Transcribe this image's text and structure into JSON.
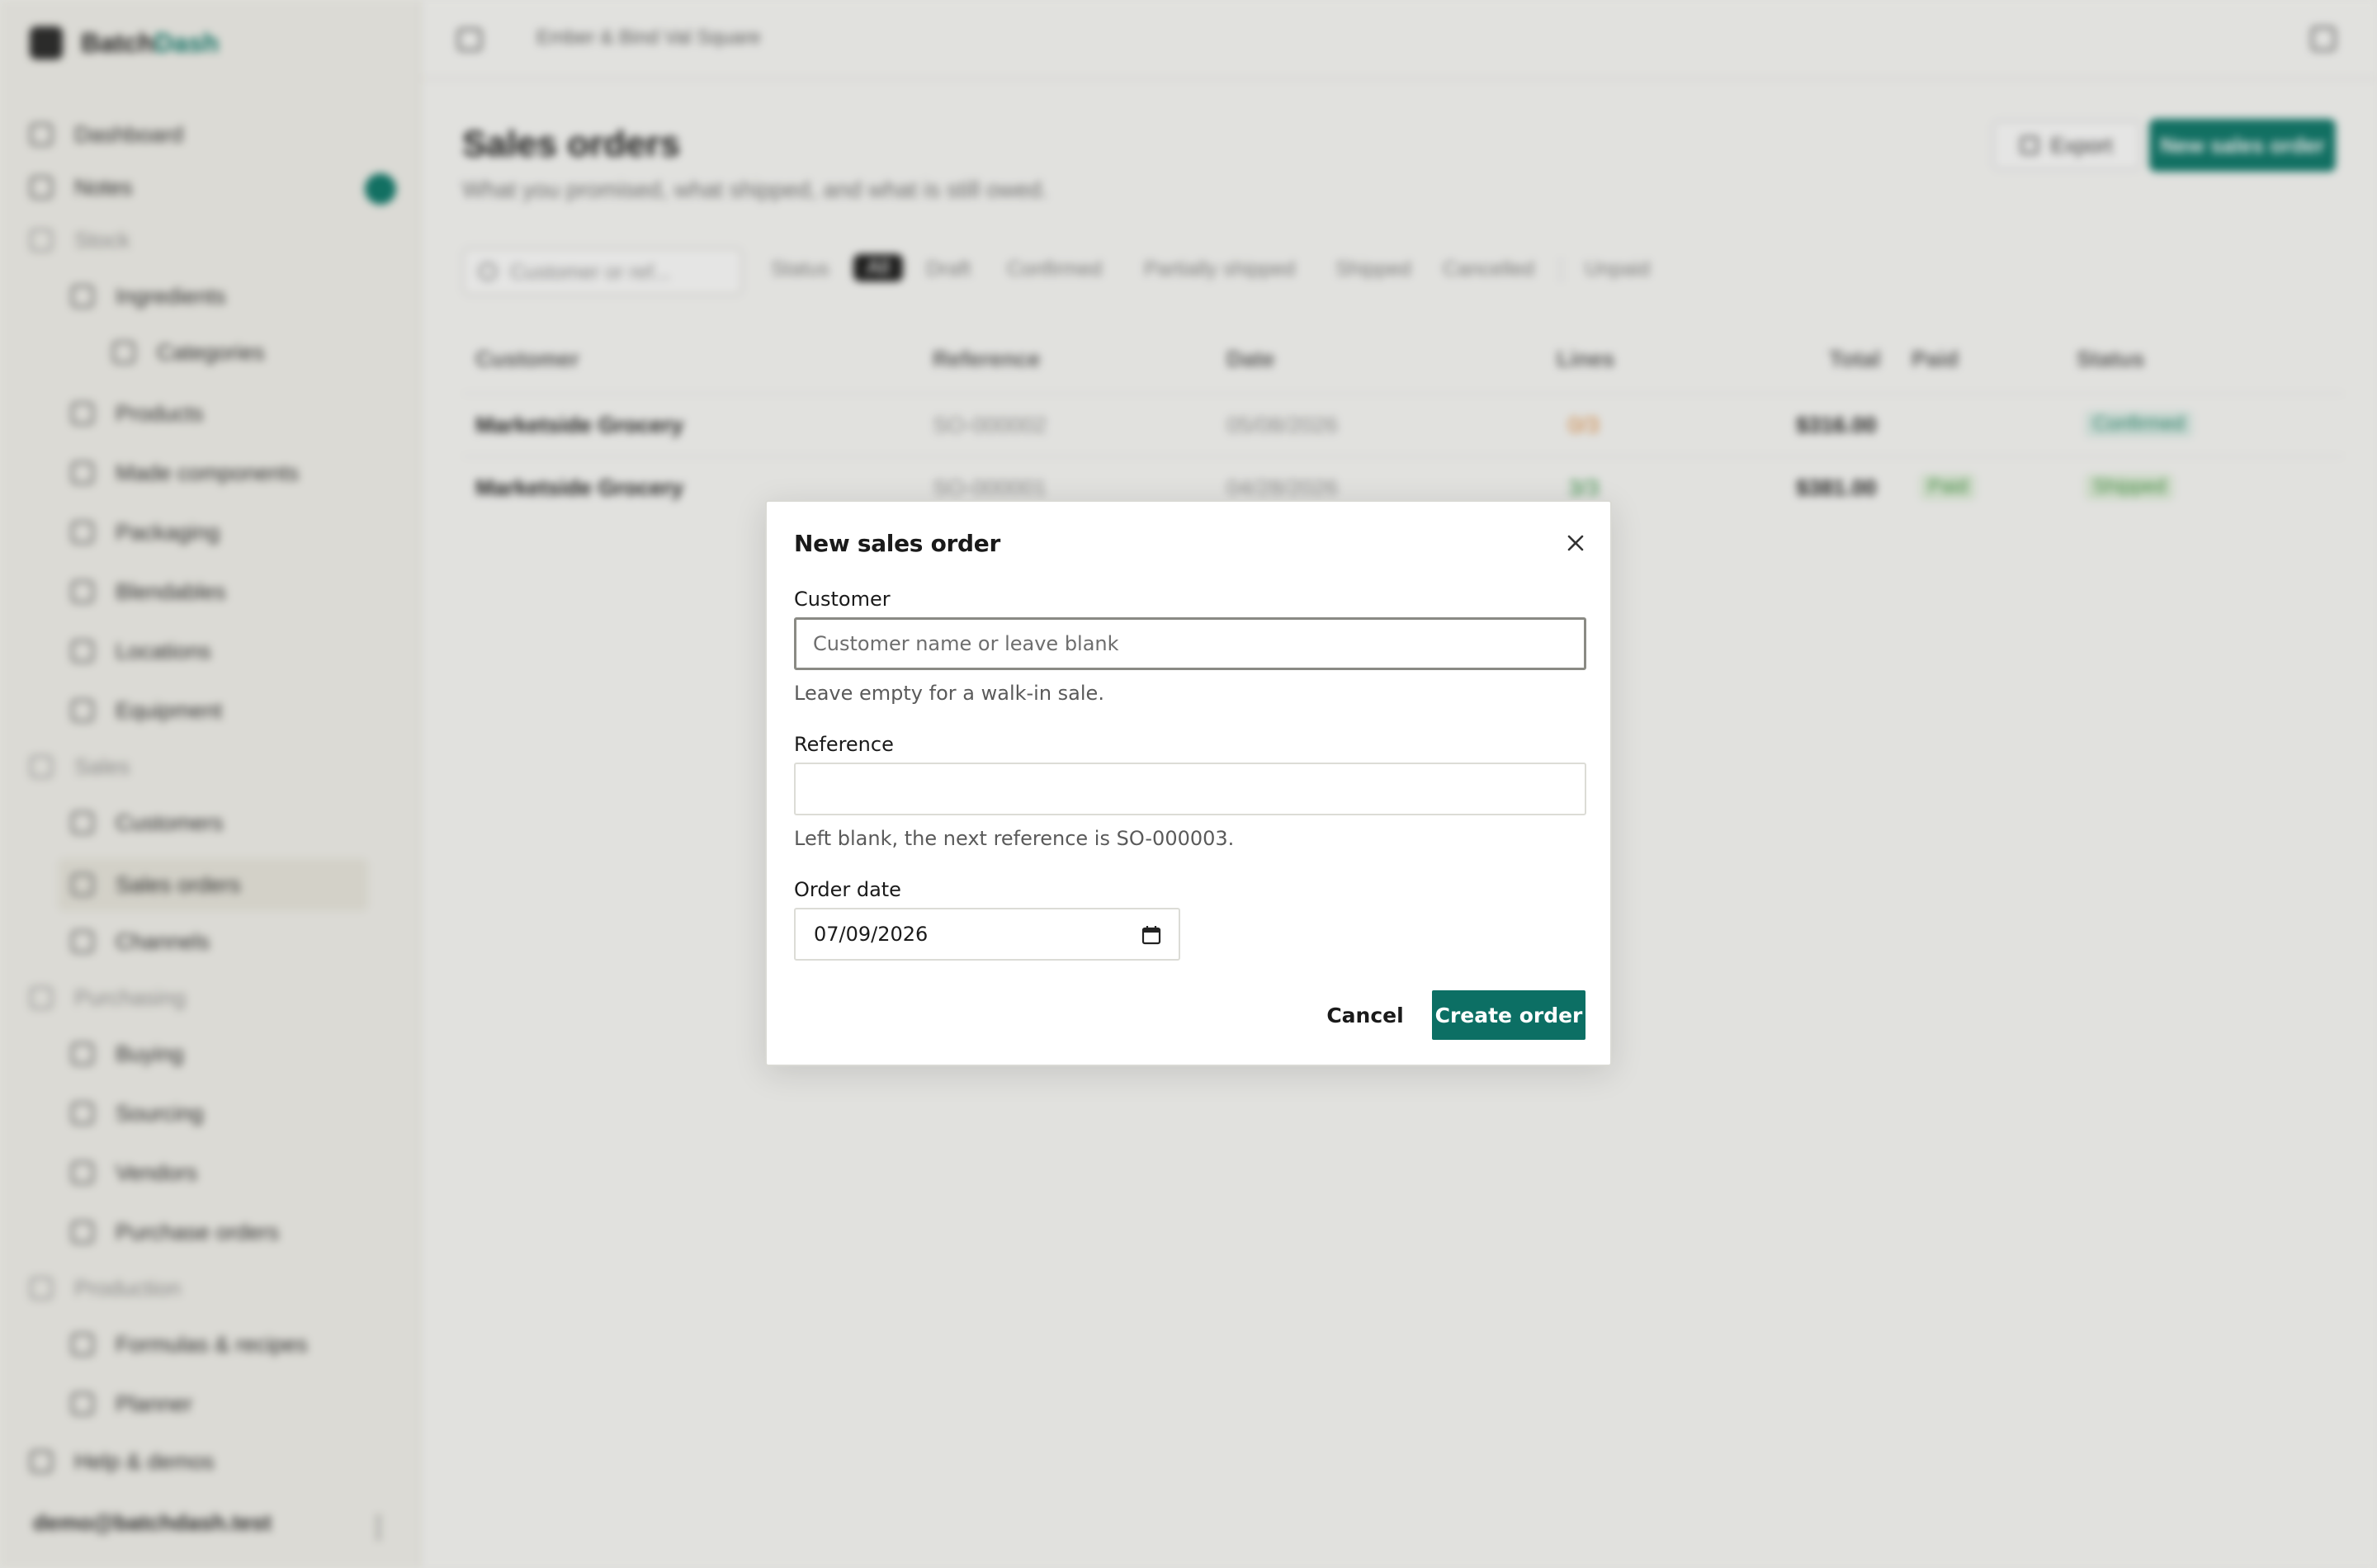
{
  "app": {
    "brand_prefix": "Batch",
    "brand_suffix": "Dash",
    "breadcrumb": "Ember & Bind Val Square",
    "user_email": "demo@batchdash.test"
  },
  "sidebar": {
    "items": [
      {
        "label": "Dashboard",
        "icon": "grid-icon"
      },
      {
        "label": "Notes",
        "icon": "note-icon"
      },
      {
        "label": "Stock",
        "icon": "box-icon"
      },
      {
        "label": "Ingredients",
        "icon": "leaf-icon"
      },
      {
        "label": "Categories",
        "icon": "tag-icon"
      },
      {
        "label": "Products",
        "icon": "cube-icon"
      },
      {
        "label": "Made components",
        "icon": "layers-icon"
      },
      {
        "label": "Packaging",
        "icon": "package-icon"
      },
      {
        "label": "Blendables",
        "icon": "flask-icon"
      },
      {
        "label": "Locations",
        "icon": "pin-icon"
      },
      {
        "label": "Equipment",
        "icon": "wrench-icon"
      },
      {
        "label": "Sales",
        "icon": "chart-icon"
      },
      {
        "label": "Customers",
        "icon": "users-icon"
      },
      {
        "label": "Sales orders",
        "icon": "receipt-icon"
      },
      {
        "label": "Channels",
        "icon": "share-icon"
      },
      {
        "label": "Purchasing",
        "icon": "cart-icon"
      },
      {
        "label": "Buying",
        "icon": "bag-icon"
      },
      {
        "label": "Sourcing",
        "icon": "globe-icon"
      },
      {
        "label": "Vendors",
        "icon": "store-icon"
      },
      {
        "label": "Purchase orders",
        "icon": "clipboard-icon"
      },
      {
        "label": "Production",
        "icon": "factory-icon"
      },
      {
        "label": "Formulas & recipes",
        "icon": "beaker-icon"
      },
      {
        "label": "Planner",
        "icon": "calendar-icon"
      },
      {
        "label": "Help & demos",
        "icon": "help-icon"
      }
    ]
  },
  "page": {
    "title": "Sales orders",
    "subtitle": "What you promised, what shipped, and what is still owed.",
    "export_label": "Export",
    "new_label": "New sales order",
    "search_placeholder": "Customer or ref...",
    "filters": [
      "Status",
      "All",
      "Draft",
      "Confirmed",
      "Partially shipped",
      "Shipped",
      "Cancelled",
      "Unpaid"
    ]
  },
  "table": {
    "columns": [
      "Customer",
      "Reference",
      "Date",
      "Lines",
      "Total",
      "Paid",
      "Status"
    ],
    "rows": [
      {
        "customer": "Marketside Grocery",
        "reference": "SO-000002",
        "date": "05/08/2026",
        "lines": "0/3",
        "total": "$316.00",
        "paid": "",
        "status": "Confirmed"
      },
      {
        "customer": "Marketside Grocery",
        "reference": "SO-000001",
        "date": "04/28/2026",
        "lines": "3/3",
        "total": "$381.00",
        "paid": "Paid",
        "status": "Shipped"
      }
    ]
  },
  "modal": {
    "title": "New sales order",
    "customer_label": "Customer",
    "customer_placeholder": "Customer name or leave blank",
    "customer_value": "",
    "customer_hint": "Leave empty for a walk-in sale.",
    "reference_label": "Reference",
    "reference_value": "",
    "reference_hint": "Left blank, the next reference is SO-000003.",
    "date_label": "Order date",
    "date_value": "07/09/2026",
    "cancel_label": "Cancel",
    "create_label": "Create order"
  },
  "colors": {
    "accent": "#0c6f64",
    "lines_warning": "#e08a3c",
    "lines_ok": "#3a9a4a"
  }
}
